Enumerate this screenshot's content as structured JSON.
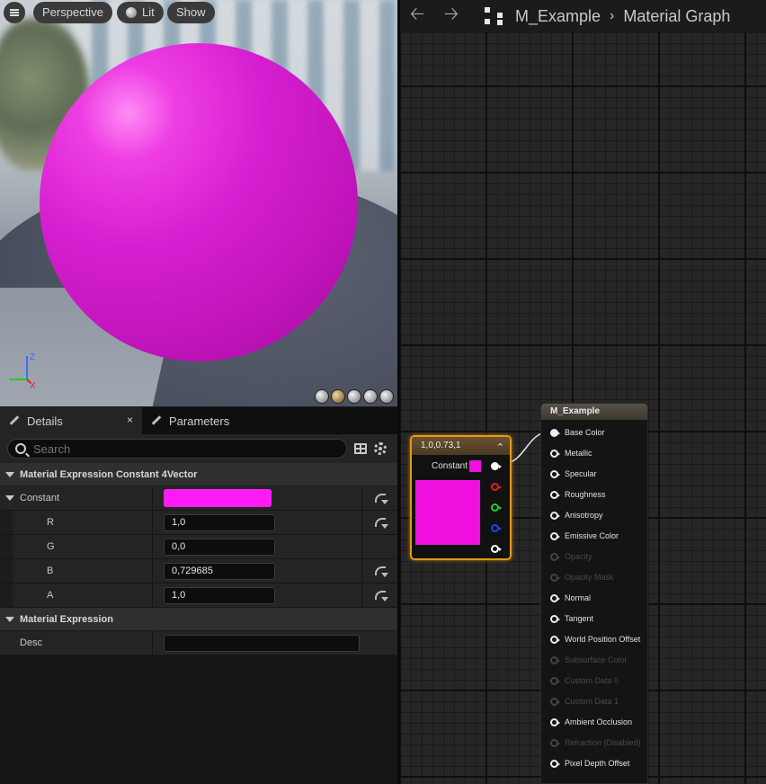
{
  "viewport": {
    "perspective_label": "Perspective",
    "lit_label": "Lit",
    "show_label": "Show",
    "axis": {
      "x": "X",
      "y": "Y",
      "z": "Z"
    },
    "sphere_color": "#d61fd0"
  },
  "details": {
    "tab_details": "Details",
    "tab_close": "×",
    "tab_parameters": "Parameters",
    "search_placeholder": "Search",
    "section_constant": "Material Expression Constant 4Vector",
    "constant_label": "Constant",
    "constant_color": "#ff1cf4",
    "components": [
      {
        "label": "R",
        "value": "1,0",
        "resettable": true
      },
      {
        "label": "G",
        "value": "0,0",
        "resettable": false
      },
      {
        "label": "B",
        "value": "0,729685",
        "resettable": true
      },
      {
        "label": "A",
        "value": "1,0",
        "resettable": true
      }
    ],
    "section_expression": "Material Expression",
    "desc_label": "Desc",
    "desc_value": ""
  },
  "graph": {
    "back_icon": "arrow-left-icon",
    "forward_icon": "arrow-right-icon",
    "breadcrumb_material": "M_Example",
    "breadcrumb_sep": "›",
    "breadcrumb_graph": "Material Graph",
    "constant_node": {
      "title": "1,0,0.73,1",
      "output_label": "Constant",
      "color": "#f010df",
      "pin_colors": [
        "#ffffff",
        "#e02020",
        "#20d020",
        "#2040ff",
        "#ffffff"
      ]
    },
    "material_node": {
      "title": "M_Example",
      "inputs": [
        {
          "label": "Base Color",
          "enabled": true,
          "connected": true
        },
        {
          "label": "Metallic",
          "enabled": true,
          "connected": false
        },
        {
          "label": "Specular",
          "enabled": true,
          "connected": false
        },
        {
          "label": "Roughness",
          "enabled": true,
          "connected": false
        },
        {
          "label": "Anisotropy",
          "enabled": true,
          "connected": false
        },
        {
          "label": "Emissive Color",
          "enabled": true,
          "connected": false
        },
        {
          "label": "Opacity",
          "enabled": false,
          "connected": false
        },
        {
          "label": "Opacity Mask",
          "enabled": false,
          "connected": false
        },
        {
          "label": "Normal",
          "enabled": true,
          "connected": false
        },
        {
          "label": "Tangent",
          "enabled": true,
          "connected": false
        },
        {
          "label": "World Position Offset",
          "enabled": true,
          "connected": false
        },
        {
          "label": "Subsurface Color",
          "enabled": false,
          "connected": false
        },
        {
          "label": "Custom Data 0",
          "enabled": false,
          "connected": false
        },
        {
          "label": "Custom Data 1",
          "enabled": false,
          "connected": false
        },
        {
          "label": "Ambient Occlusion",
          "enabled": true,
          "connected": false
        },
        {
          "label": "Refraction (Disabled)",
          "enabled": false,
          "connected": false
        },
        {
          "label": "Pixel Depth Offset",
          "enabled": true,
          "connected": false
        }
      ]
    }
  }
}
